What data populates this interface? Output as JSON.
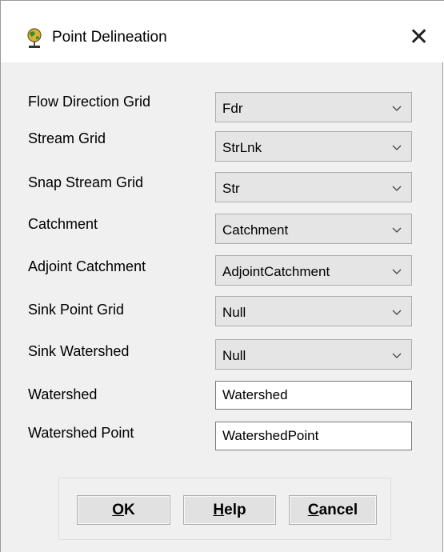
{
  "dialog": {
    "title": "Point Delineation",
    "title_icon": "globe-pin-icon",
    "close_symbol": "✕"
  },
  "fields": [
    {
      "label": "Flow Direction Grid",
      "type": "combo",
      "value": "Fdr"
    },
    {
      "label": "Stream Grid",
      "type": "combo",
      "value": "StrLnk"
    },
    {
      "label": "Snap Stream Grid",
      "type": "combo",
      "value": "Str"
    },
    {
      "label": "Catchment",
      "type": "combo",
      "value": "Catchment"
    },
    {
      "label": "Adjoint Catchment",
      "type": "combo",
      "value": "AdjointCatchment"
    },
    {
      "label": "Sink Point Grid",
      "type": "combo",
      "value": "Null"
    },
    {
      "label": "Sink Watershed",
      "type": "combo",
      "value": "Null"
    },
    {
      "label": "Watershed",
      "type": "text",
      "value": "Watershed"
    },
    {
      "label": "Watershed Point",
      "type": "text",
      "value": "WatershedPoint"
    }
  ],
  "buttons": {
    "ok": {
      "label": "OK",
      "mnemonic": "O"
    },
    "help": {
      "label": "Help",
      "mnemonic": "H"
    },
    "cancel": {
      "label": "Cancel",
      "mnemonic": "C"
    }
  },
  "colors": {
    "window_bg": "#f0f0f0",
    "titlebar_bg": "#ffffff",
    "combo_bg": "#e5e5e5",
    "button_bg": "#e1e1e1"
  }
}
